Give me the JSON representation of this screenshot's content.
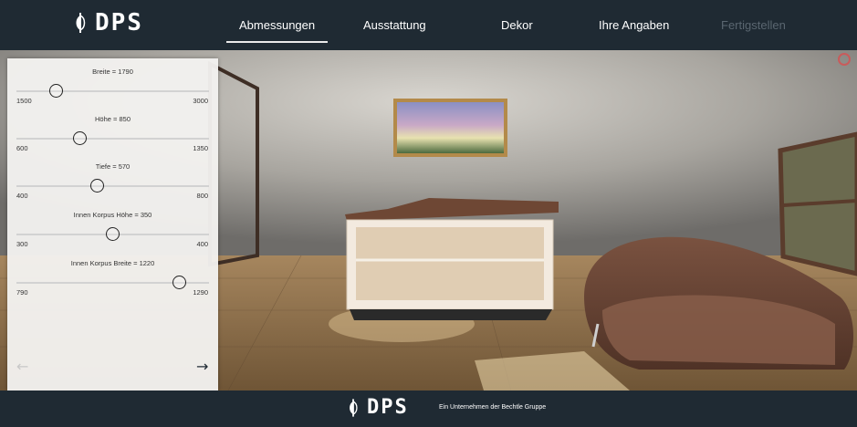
{
  "brand": {
    "name": "DPS"
  },
  "nav": {
    "tabs": [
      {
        "label": "Abmessungen"
      },
      {
        "label": "Ausstattung"
      },
      {
        "label": "Dekor"
      },
      {
        "label": "Ihre Angaben"
      },
      {
        "label": "Fertigstellen"
      }
    ]
  },
  "sliders": [
    {
      "label": "Breite = 1790",
      "min": "1500",
      "max": "3000",
      "value": 1790
    },
    {
      "label": "Höhe = 850",
      "min": "600",
      "max": "1350",
      "value": 850
    },
    {
      "label": "Tiefe = 570",
      "min": "400",
      "max": "800",
      "value": 570
    },
    {
      "label": "Innen Korpus Höhe = 350",
      "min": "300",
      "max": "400",
      "value": 350
    },
    {
      "label": "Innen Korpus Breite = 1220",
      "min": "790",
      "max": "1290",
      "value": 1220
    }
  ],
  "nav_arrows": {
    "prev": "←",
    "next": "→"
  },
  "footer": {
    "brand": "DPS",
    "tagline": "Ein Unternehmen der Bechtle Gruppe"
  },
  "colors": {
    "bar": "#1f2a33",
    "panel": "#f3f1ef",
    "close": "#c95b5b"
  }
}
